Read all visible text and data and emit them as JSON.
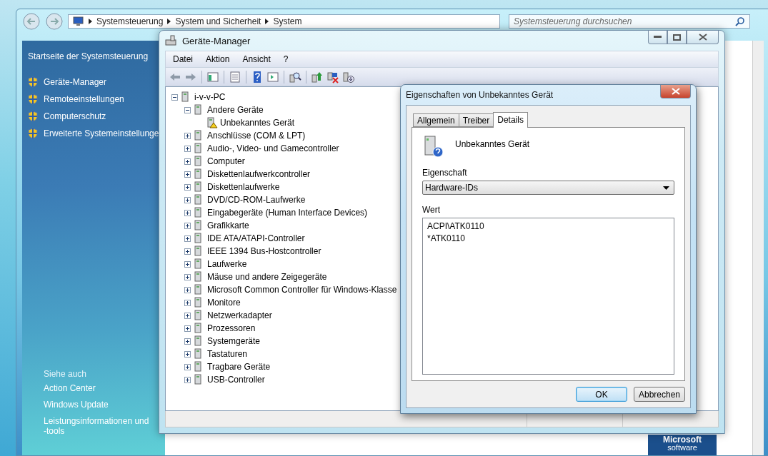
{
  "control_panel": {
    "breadcrumb": [
      "Systemsteuerung",
      "System und Sicherheit",
      "System"
    ],
    "search": {
      "placeholder": "Systemsteuerung durchsuchen"
    },
    "home_link": "Startseite der Systemsteuerung",
    "tasks": [
      "Geräte-Manager",
      "Remoteeinstellungen",
      "Computerschutz",
      "Erweiterte Systemeinstellunge"
    ],
    "see_also": {
      "heading": "Siehe auch",
      "links": [
        "Action Center",
        "Windows Update",
        "Leistungsinformationen und -tools"
      ]
    },
    "logo": {
      "line_1": "Microsoft",
      "line_2": "software"
    }
  },
  "device_manager": {
    "title": "Geräte-Manager",
    "menu": [
      "Datei",
      "Aktion",
      "Ansicht",
      "?"
    ],
    "tree": {
      "label": "i-v-v-PC",
      "expanded": true,
      "children": [
        {
          "label": "Andere Geräte",
          "expanded": true,
          "children": [
            {
              "label": "Unbekanntes Gerät",
              "warning": true
            }
          ]
        },
        {
          "label": "Anschlüsse (COM & LPT)",
          "expanded": false
        },
        {
          "label": "Audio-, Video- und Gamecontroller",
          "expanded": false
        },
        {
          "label": "Computer",
          "expanded": false
        },
        {
          "label": "Diskettenlaufwerkcontroller",
          "expanded": false
        },
        {
          "label": "Diskettenlaufwerke",
          "expanded": false
        },
        {
          "label": "DVD/CD-ROM-Laufwerke",
          "expanded": false
        },
        {
          "label": "Eingabegeräte (Human Interface Devices)",
          "expanded": false
        },
        {
          "label": "Grafikkarte",
          "expanded": false
        },
        {
          "label": "IDE ATA/ATAPI-Controller",
          "expanded": false
        },
        {
          "label": "IEEE 1394 Bus-Hostcontroller",
          "expanded": false
        },
        {
          "label": "Laufwerke",
          "expanded": false
        },
        {
          "label": "Mäuse und andere Zeigegeräte",
          "expanded": false
        },
        {
          "label": "Microsoft Common Controller für Windows-Klasse",
          "expanded": false
        },
        {
          "label": "Monitore",
          "expanded": false
        },
        {
          "label": "Netzwerkadapter",
          "expanded": false
        },
        {
          "label": "Prozessoren",
          "expanded": false
        },
        {
          "label": "Systemgeräte",
          "expanded": false
        },
        {
          "label": "Tastaturen",
          "expanded": false
        },
        {
          "label": "Tragbare Geräte",
          "expanded": false
        },
        {
          "label": "USB-Controller",
          "expanded": false
        }
      ]
    }
  },
  "properties_dialog": {
    "title": "Eigenschaften von Unbekanntes Gerät",
    "tabs": [
      {
        "label": "Allgemein",
        "selected": false
      },
      {
        "label": "Treiber",
        "selected": false
      },
      {
        "label": "Details",
        "selected": true
      }
    ],
    "device_name": "Unbekanntes Gerät",
    "property_label": "Eigenschaft",
    "property_value": "Hardware-IDs",
    "value_label": "Wert",
    "values": [
      "ACPI\\ATK0110",
      "*ATK0110"
    ],
    "buttons": [
      {
        "label": "OK",
        "default": true
      },
      {
        "label": "Abbrechen",
        "default": false
      }
    ]
  }
}
